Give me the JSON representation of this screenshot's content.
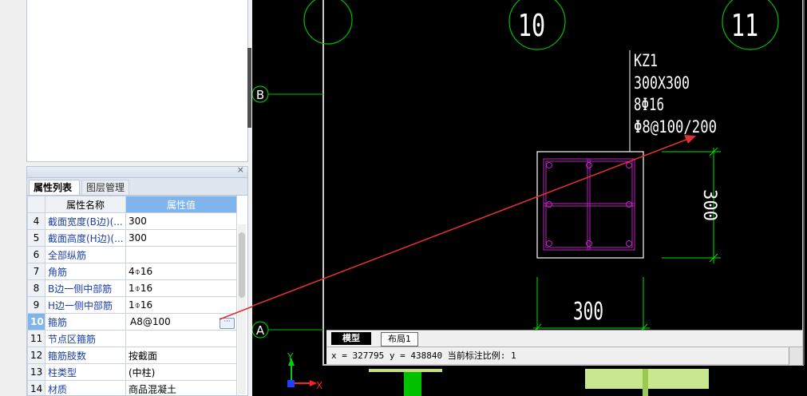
{
  "panel": {
    "close_glyph": "×",
    "tabs": [
      "属性列表",
      "图层管理"
    ],
    "columns": {
      "name": "属性名称",
      "value": "属性值"
    },
    "rows": [
      {
        "num": "4",
        "name": "截面宽度(B边)(...",
        "value": "300"
      },
      {
        "num": "5",
        "name": "截面高度(H边)(...",
        "value": "300"
      },
      {
        "num": "6",
        "name": "全部纵筋",
        "value": ""
      },
      {
        "num": "7",
        "name": "角筋",
        "value": "4⌽16"
      },
      {
        "num": "8",
        "name": "B边一侧中部筋",
        "value": "1⌽16"
      },
      {
        "num": "9",
        "name": "H边一侧中部筋",
        "value": "1⌽16"
      },
      {
        "num": "10",
        "name": "箍筋",
        "value": "A8@100",
        "selected": true
      },
      {
        "num": "11",
        "name": "节点区箍筋",
        "value": ""
      },
      {
        "num": "12",
        "name": "箍筋肢数",
        "value": "按截面"
      },
      {
        "num": "13",
        "name": "柱类型",
        "value": "(中柱)"
      },
      {
        "num": "14",
        "name": "材质",
        "value": "商品混凝土"
      }
    ],
    "ellipsis": "···"
  },
  "canvas": {
    "axis_labels": {
      "col_10": "10",
      "col_11": "11",
      "row_B": "B",
      "row_A": "A"
    },
    "column_annotation": {
      "name": "KZ1",
      "section": "300X300",
      "main_rebar": "8Φ16",
      "stirrup": "Φ8@100/200"
    },
    "dimension_right": "300",
    "dimension_bottom": "300",
    "ucs": {
      "y": "Y",
      "x": "X"
    },
    "colors": {
      "grid": "#00c000",
      "column": "#ffffff",
      "rebar": "#c020c0",
      "dimension": "#00e000",
      "arrow": "#e03030"
    }
  },
  "layout_tabs": [
    "模型",
    "布局1"
  ],
  "status": {
    "text": "x = 327795 y = 438840 当前标注比例: 1"
  }
}
